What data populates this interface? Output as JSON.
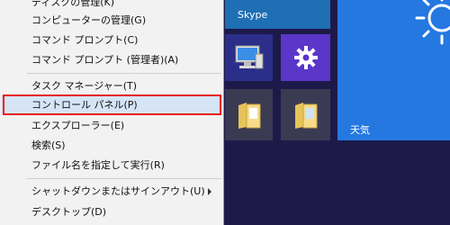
{
  "colors": {
    "start_background": "#1d1a4a",
    "menu_background": "#f2f2f2",
    "menu_selected": "#d5e5f6",
    "highlight_outline": "#e8191a",
    "skype_tile": "#1f6fb5",
    "settings_tile": "#5a36c9",
    "weather_tile": "#2478e0"
  },
  "context_menu": {
    "items": [
      {
        "label": "ディスクの管理(K)"
      },
      {
        "label": "コンピューターの管理(G)"
      },
      {
        "label": "コマンド プロンプト(C)"
      },
      {
        "label": "コマンド プロンプト (管理者)(A)"
      },
      {
        "label": "タスク マネージャー(T)"
      },
      {
        "label": "コントロール パネル(P)"
      },
      {
        "label": "エクスプローラー(E)"
      },
      {
        "label": "検索(S)"
      },
      {
        "label": "ファイル名を指定して実行(R)"
      },
      {
        "label": "シャットダウンまたはサインアウト(U)"
      },
      {
        "label": "デスクトップ(D)"
      }
    ],
    "selected_item": "コントロール パネル(P)"
  },
  "tiles": {
    "skype": {
      "label": "Skype"
    },
    "computer": {
      "icon": "computer-icon"
    },
    "settings": {
      "icon": "gear-icon"
    },
    "folder_1": {
      "icon": "folder-icon"
    },
    "folder_2": {
      "icon": "folder-icon"
    },
    "weather": {
      "label": "天気",
      "icon": "sun-icon"
    }
  }
}
